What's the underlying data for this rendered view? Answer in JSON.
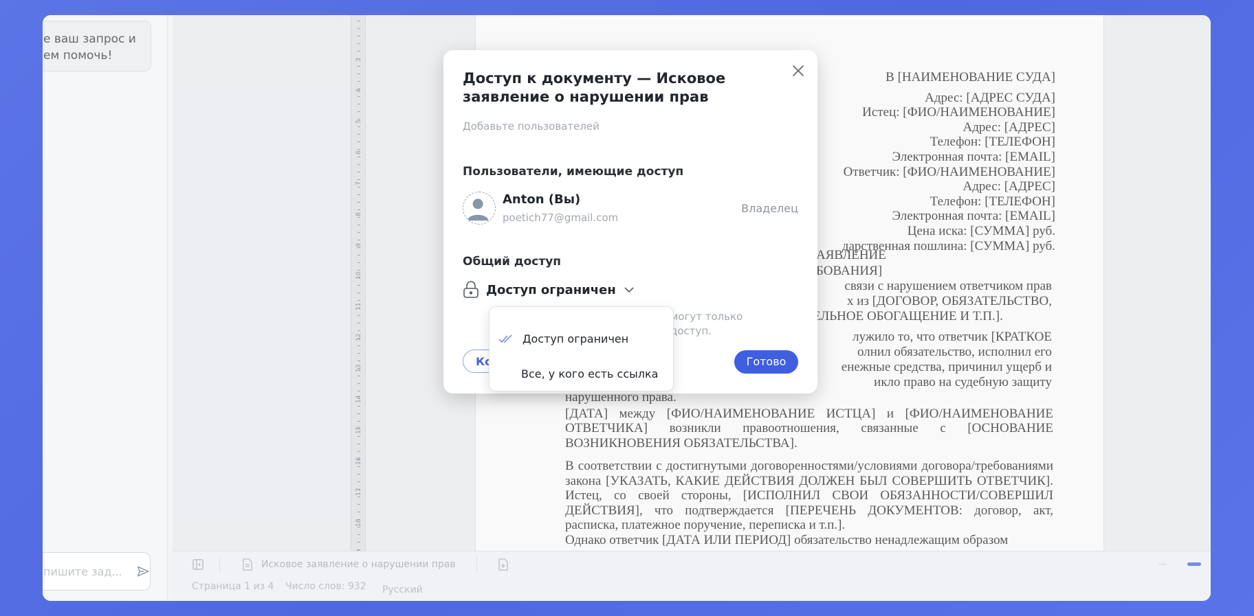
{
  "chat": {
    "bubble_line1": "е ваш запрос и",
    "bubble_line2": "ем помочь!",
    "input_placeholder": "пишите зад..."
  },
  "ruler": {
    "labels": [
      "3",
      "4",
      "5",
      "6",
      "7",
      "8",
      "9",
      "10",
      "11",
      "12",
      "13",
      "14",
      "15",
      "16",
      "17",
      "18",
      "19"
    ]
  },
  "document": {
    "header_lines": [
      "В [НАИМЕНОВАНИЕ СУДА]",
      "Адрес: [АДРЕС СУДА]",
      "Истец: [ФИО/НАИМЕНОВАНИЕ]",
      "Адрес: [АДРЕС]",
      "Телефон: [ТЕЛЕФОН]",
      "Электронная почта: [EMAIL]",
      "Ответчик: [ФИО/НАИМЕНОВАНИЕ]",
      "Адрес: [АДРЕС]",
      "Телефон: [ТЕЛЕФОН]",
      "Электронная почта: [EMAIL]",
      "Цена иска: [СУММА] руб.",
      "дарственная пошлина: [СУММА] руб."
    ],
    "frag_zayavlenie": "АЯВЛЕНИЕ",
    "frag_bovaniya": "БОВАНИЯ]",
    "frag_p1_l1": "связи с нарушением ответчиком прав",
    "frag_p1_l2": "х из [ДОГОВОР, ОБЯЗАТЕЛЬСТВО,",
    "frag_p1_l3": "ЕЛЬНОЕ ОБОГАЩЕНИЕ И Т.П.].",
    "frag_p2_l1": "лужило то, что ответчик [КРАТКОЕ",
    "frag_p2_l2": "олнил обязательство, исполнил его",
    "frag_p2_l3": "енежные средства, причинил ущерб и",
    "frag_p2_l4": "икло право на судебную защиту",
    "p2_end": "нарушенного права.",
    "p3": "[ДАТА] между [ФИО/НАИМЕНОВАНИЕ ИСТЦА] и [ФИО/НАИМЕНОВАНИЕ ОТВЕТЧИКА] возникли правоотношения, связанные с [ОСНОВАНИЕ ВОЗНИКНОВЕНИЯ ОБЯЗАТЕЛЬСТВА].",
    "p4": "В соответствии с достигнутыми договоренностями/условиями договора/требованиями закона [УКАЗАТЬ, КАКИЕ ДЕЙСТВИЯ ДОЛЖЕН БЫЛ СОВЕРШИТЬ ОТВЕТЧИК]. Истец, со своей стороны, [ИСПОЛНИЛ СВОИ ОБЯЗАННОСТИ/СОВЕРШИЛ ДЕЙСТВИЯ], что подтверждается [ПЕРЕЧЕНЬ ДОКУМЕНТОВ: договор, акт, расписка, платежное поручение, переписка и т.п.].",
    "p5_cut": "Однако ответчик [ДАТА ИЛИ ПЕРИОД] обязательство ненадлежащим образом"
  },
  "tabbar": {
    "doc_tab": "Исковое заявление о нарушении прав"
  },
  "statusbar": {
    "page": "Страница 1 из 4",
    "words": "Число слов: 932",
    "lang": "Русский"
  },
  "dialog": {
    "title": "Доступ к документу — Исковое заявление о нарушении прав",
    "add_users_placeholder": "Добавьте пользователей",
    "users_header": "Пользователи, имеющие доступ",
    "user_name": "Anton (Вы)",
    "user_email": "poetich77@gmail.com",
    "user_role": "Владелец",
    "general_header": "Общий доступ",
    "access_value": "Доступ ограничен",
    "access_hint_l1": "могут только",
    "access_hint_l2": "доступ.",
    "copy_label": "Ко",
    "done_label": "Готово"
  },
  "dropdown": {
    "options": [
      "Доступ ограничен",
      "Все, у кого есть ссылка"
    ],
    "selected": "Доступ ограничен"
  },
  "colors": {
    "accent": "#3f5fe0",
    "background": "#5b74e6"
  }
}
